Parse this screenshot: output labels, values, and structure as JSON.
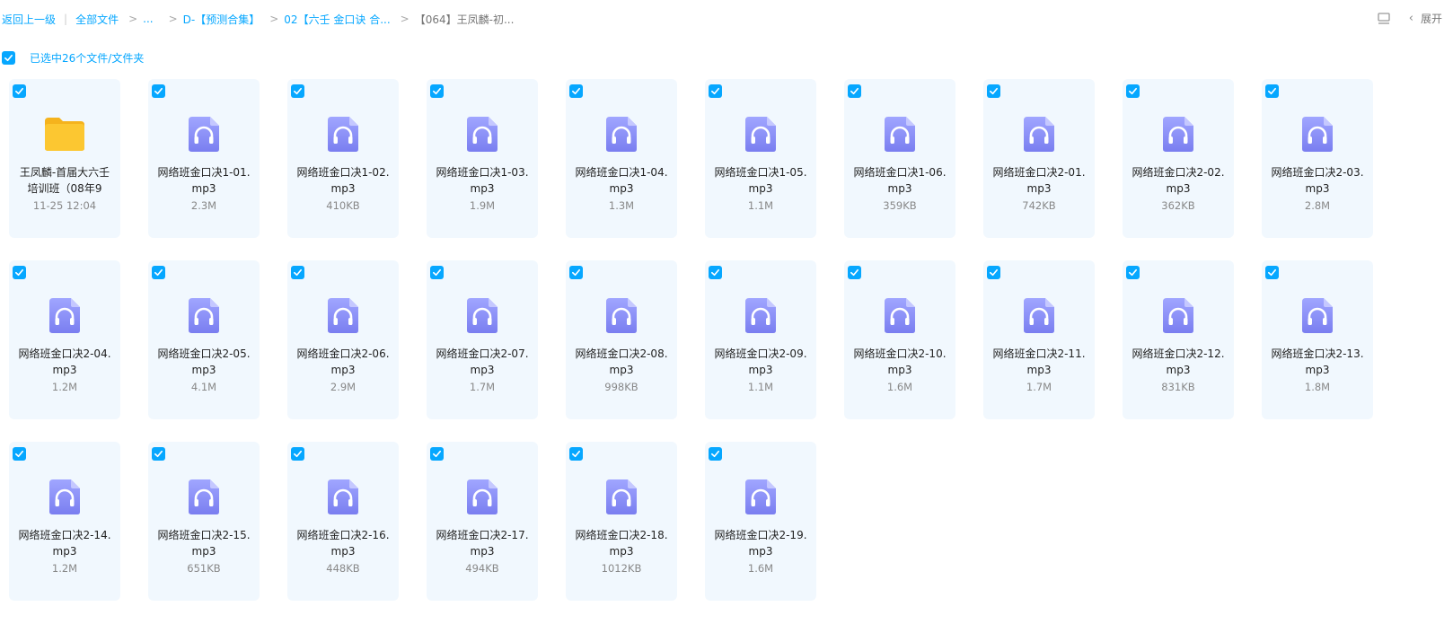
{
  "breadcrumb": {
    "back": "返回上一级",
    "items": [
      {
        "label": "全部文件"
      },
      {
        "label": "..."
      },
      {
        "label": "D-【预测合集】"
      },
      {
        "label": "02【六壬 金口诀 合..."
      }
    ],
    "current": "【064】王凤麟-初..."
  },
  "toolbar": {
    "tool_icon": "list-view-icon",
    "expand_label": "展开"
  },
  "selection": {
    "text": "已选中26个文件/文件夹"
  },
  "colors": {
    "accent": "#06a7ff",
    "card_bg": "#f1f8fe",
    "audio_icon": "#8b8df6",
    "folder": "#fcc731"
  },
  "files": [
    {
      "type": "folder",
      "name": "王凤麟-首届大六壬培训班（08年9",
      "meta": "11-25 12:04"
    },
    {
      "type": "audio",
      "name": "网络班金口决1-01.mp3",
      "meta": "2.3M"
    },
    {
      "type": "audio",
      "name": "网络班金口决1-02.mp3",
      "meta": "410KB"
    },
    {
      "type": "audio",
      "name": "网络班金口决1-03.mp3",
      "meta": "1.9M"
    },
    {
      "type": "audio",
      "name": "网络班金口决1-04.mp3",
      "meta": "1.3M"
    },
    {
      "type": "audio",
      "name": "网络班金口决1-05.mp3",
      "meta": "1.1M"
    },
    {
      "type": "audio",
      "name": "网络班金口决1-06.mp3",
      "meta": "359KB"
    },
    {
      "type": "audio",
      "name": "网络班金口决2-01.mp3",
      "meta": "742KB"
    },
    {
      "type": "audio",
      "name": "网络班金口决2-02.mp3",
      "meta": "362KB"
    },
    {
      "type": "audio",
      "name": "网络班金口决2-03.mp3",
      "meta": "2.8M"
    },
    {
      "type": "audio",
      "name": "网络班金口决2-04.mp3",
      "meta": "1.2M"
    },
    {
      "type": "audio",
      "name": "网络班金口决2-05.mp3",
      "meta": "4.1M"
    },
    {
      "type": "audio",
      "name": "网络班金口决2-06.mp3",
      "meta": "2.9M"
    },
    {
      "type": "audio",
      "name": "网络班金口决2-07.mp3",
      "meta": "1.7M"
    },
    {
      "type": "audio",
      "name": "网络班金口决2-08.mp3",
      "meta": "998KB"
    },
    {
      "type": "audio",
      "name": "网络班金口决2-09.mp3",
      "meta": "1.1M"
    },
    {
      "type": "audio",
      "name": "网络班金口决2-10.mp3",
      "meta": "1.6M"
    },
    {
      "type": "audio",
      "name": "网络班金口决2-11.mp3",
      "meta": "1.7M"
    },
    {
      "type": "audio",
      "name": "网络班金口决2-12.mp3",
      "meta": "831KB"
    },
    {
      "type": "audio",
      "name": "网络班金口决2-13.mp3",
      "meta": "1.8M"
    },
    {
      "type": "audio",
      "name": "网络班金口决2-14.mp3",
      "meta": "1.2M"
    },
    {
      "type": "audio",
      "name": "网络班金口决2-15.mp3",
      "meta": "651KB"
    },
    {
      "type": "audio",
      "name": "网络班金口决2-16.mp3",
      "meta": "448KB"
    },
    {
      "type": "audio",
      "name": "网络班金口决2-17.mp3",
      "meta": "494KB"
    },
    {
      "type": "audio",
      "name": "网络班金口决2-18.mp3",
      "meta": "1012KB"
    },
    {
      "type": "audio",
      "name": "网络班金口决2-19.mp3",
      "meta": "1.6M"
    }
  ]
}
